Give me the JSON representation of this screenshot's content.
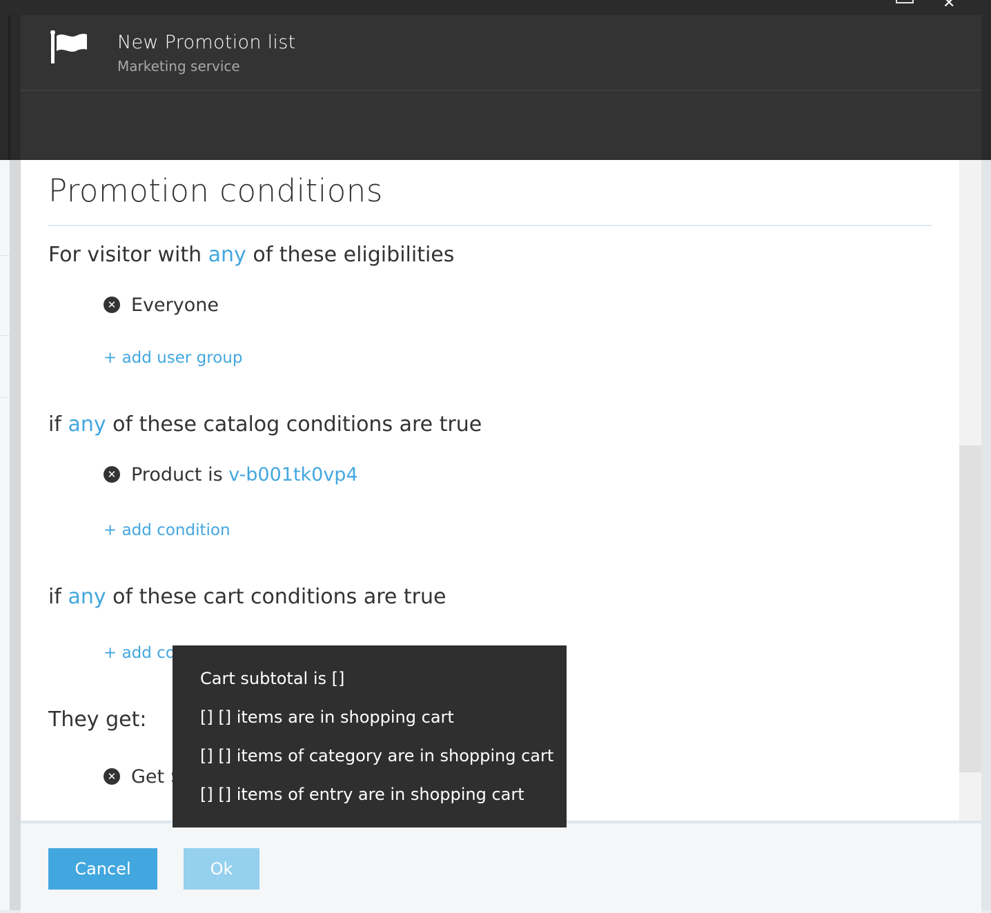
{
  "blade": {
    "title": "New Promotion list",
    "subtitle": "Marketing service"
  },
  "section": {
    "title": "Promotion conditions"
  },
  "eligibility": {
    "prefix": "For visitor with ",
    "any": "any",
    "suffix": " of these eligibilities",
    "items": [
      {
        "label": "Everyone"
      }
    ],
    "add_label": "+ add user group"
  },
  "catalog": {
    "prefix": "if ",
    "any": "any",
    "suffix": " of these catalog conditions are true",
    "items": [
      {
        "label": "Product is ",
        "value": "v-b001tk0vp4"
      }
    ],
    "add_label": "+ add condition"
  },
  "cart": {
    "prefix": "if ",
    "any": "any",
    "suffix": " of these cart conditions are true",
    "add_label": "+ add con"
  },
  "rewards": {
    "heading": "They get:",
    "items": [
      {
        "label": "Get $"
      }
    ]
  },
  "menu": {
    "items": [
      "Cart subtotal is []",
      "[] [] items are in shopping cart",
      "[] [] items of category are in shopping cart",
      "[] [] items of entry are in shopping cart"
    ]
  },
  "footer": {
    "cancel_label": "Cancel",
    "ok_label": "Ok"
  },
  "colors": {
    "accent": "#43a7df",
    "header_bg": "#333333",
    "menu_bg": "#2f2f2f"
  }
}
